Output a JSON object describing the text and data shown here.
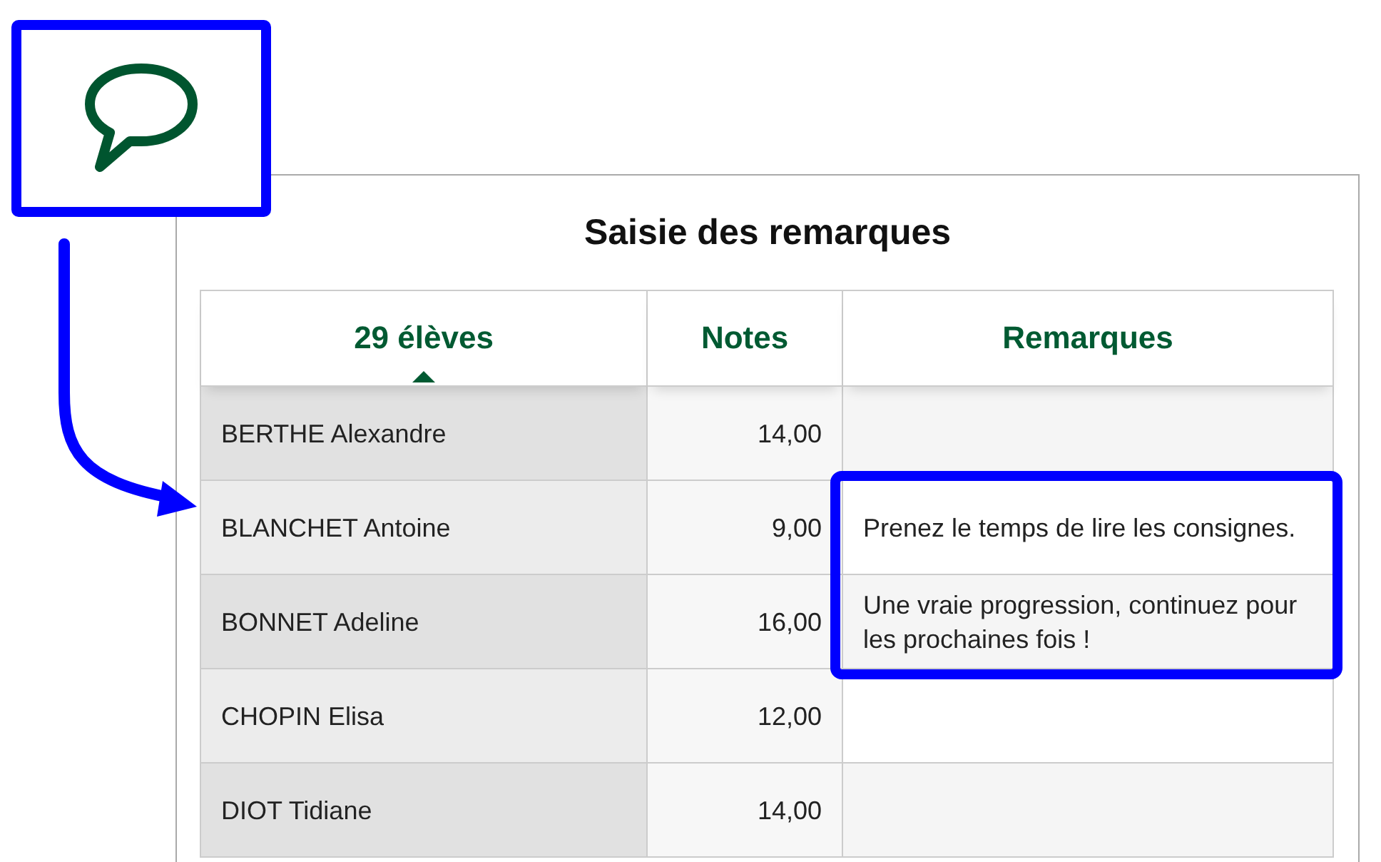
{
  "title": "Saisie des remarques",
  "columns": [
    {
      "label": "29 élèves",
      "sorted": true
    },
    {
      "label": "Notes",
      "sorted": false
    },
    {
      "label": "Remarques",
      "sorted": false
    }
  ],
  "rows": [
    {
      "name": "BERTHE Alexandre",
      "note": "14,00"
    },
    {
      "name": "BLANCHET Antoine",
      "note": "9,00",
      "remark": "Prenez le temps de lire les consignes."
    },
    {
      "name": "BONNET Adeline",
      "note": "16,00",
      "remark": "Une vraie progression, continuez pour les prochaines fois !"
    },
    {
      "name": "CHOPIN Elisa",
      "note": "12,00"
    },
    {
      "name": "DIOT Tidiane",
      "note": "14,00"
    }
  ]
}
